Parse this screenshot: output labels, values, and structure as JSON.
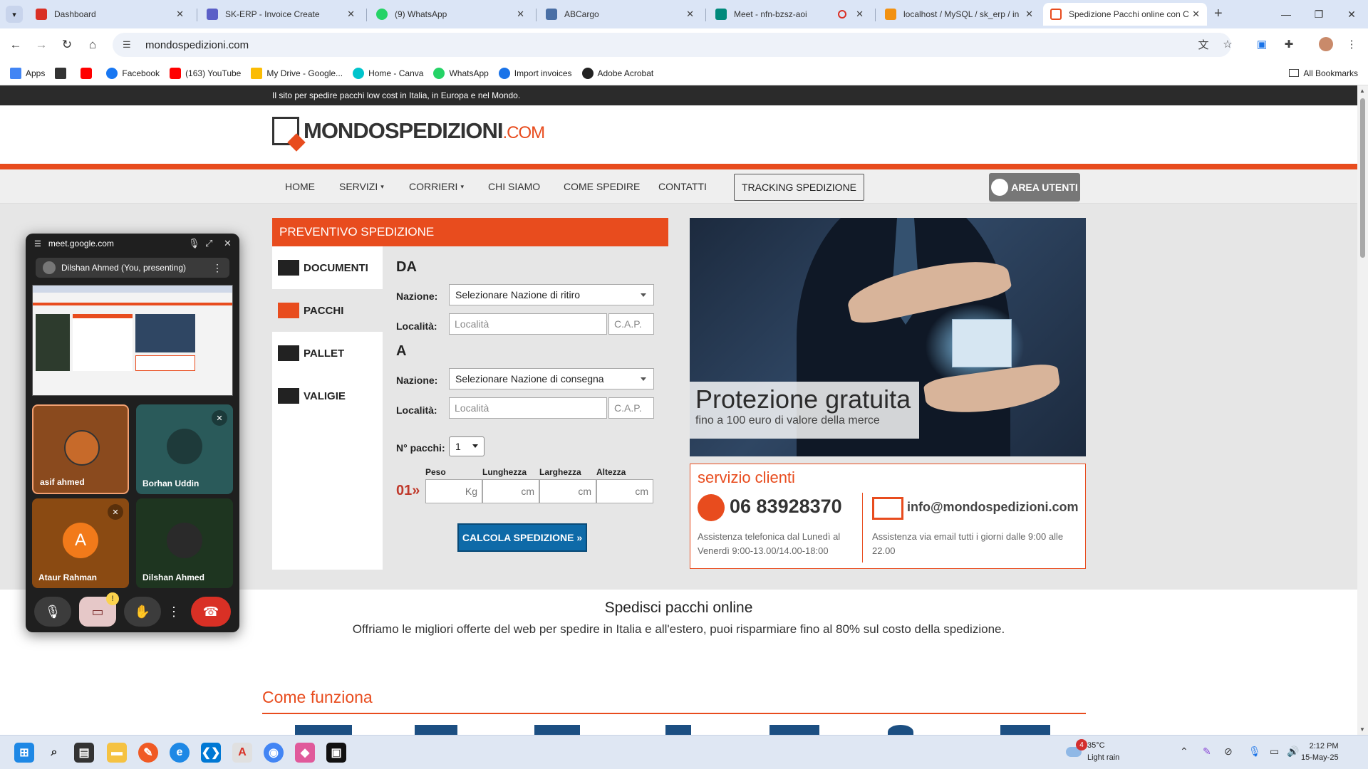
{
  "browser": {
    "tabs": [
      {
        "title": "Dashboard",
        "color": "#d93025"
      },
      {
        "title": "SK-ERP - Invoice Create",
        "color": "#5b5fc7"
      },
      {
        "title": "(9) WhatsApp",
        "color": "#25d366"
      },
      {
        "title": "ABCargo",
        "color": "#4a6fa5"
      },
      {
        "title": "Meet - nfn-bzsz-aoi",
        "color": "#00897b"
      },
      {
        "title": "localhost / MySQL / sk_erp / in",
        "color": "#f29111"
      },
      {
        "title": "Spedizione Pacchi online con C",
        "color": "#e84c1e"
      }
    ],
    "url": "mondospedizioni.com",
    "bookmarks": [
      {
        "label": "Apps",
        "icon": "apps-grid-icon",
        "color": "#4285f4"
      },
      {
        "label": "",
        "icon": "grid-icon",
        "color": "#333333"
      },
      {
        "label": "",
        "icon": "youtube-icon",
        "color": "#ff0000"
      },
      {
        "label": "Facebook",
        "icon": "facebook-icon",
        "color": "#1877f2"
      },
      {
        "label": "(163) YouTube",
        "icon": "youtube-icon",
        "color": "#ff0000"
      },
      {
        "label": "My Drive - Google...",
        "icon": "drive-icon",
        "color": "#fbbc04"
      },
      {
        "label": "Home - Canva",
        "icon": "canva-icon",
        "color": "#00c4cc"
      },
      {
        "label": "WhatsApp",
        "icon": "whatsapp-icon",
        "color": "#25d366"
      },
      {
        "label": "Import invoices",
        "icon": "import-icon",
        "color": "#1a73e8"
      },
      {
        "label": "Adobe Acrobat",
        "icon": "acrobat-icon",
        "color": "#222222"
      }
    ],
    "all_bookmarks": "All Bookmarks"
  },
  "site": {
    "topbar": "Il sito per spedire pacchi low cost in Italia, in Europa e nel Mondo.",
    "logo_main": "MONDOSPEDIZIONI",
    "logo_com": ".COM",
    "nav": [
      "HOME",
      "SERVIZI",
      "CORRIERI",
      "CHI SIAMO",
      "COME SPEDIRE",
      "CONTATTI"
    ],
    "nav_tracking": "TRACKING SPEDIZIONE",
    "nav_area": "AREA UTENTI",
    "quote": {
      "title": "PREVENTIVO SPEDIZIONE",
      "tabs": [
        "DOCUMENTI",
        "PACCHI",
        "PALLET",
        "VALIGIE"
      ],
      "da": "DA",
      "a": "A",
      "nazione_label": "Nazione:",
      "localita_label": "Località:",
      "nazione_ritiro": "Selezionare Nazione di ritiro",
      "nazione_consegna": "Selezionare Nazione di consegna",
      "localita_placeholder": "Località",
      "cap_placeholder": "C.A.P.",
      "npacchi_label": "N° pacchi:",
      "npacchi_value": "1",
      "dims": [
        "Peso",
        "Lunghezza",
        "Larghezza",
        "Altezza"
      ],
      "units": [
        "Kg",
        "cm",
        "cm",
        "cm"
      ],
      "row": "01»",
      "calc": "CALCOLA SPEDIZIONE »"
    },
    "promo": {
      "title": "Protezione gratuita",
      "subtitle": "fino a 100 euro di valore della merce"
    },
    "service": {
      "title": "servizio clienti",
      "phone": "06 83928370",
      "phone_text": "Assistenza telefonica dal Lunedì al Venerdì 9:00-13.00/14.00-18:00",
      "email": "info@mondospedizioni.com",
      "email_text": "Assistenza via email tutti i giorni dalle 9:00 alle 22.00"
    },
    "section_title": "Spedisci pacchi online",
    "section_sub": "Offriamo le migliori offerte del web per spedire in Italia e all'estero, puoi risparmiare fino al 80% sul costo della spedizione.",
    "come_title": "Come funziona"
  },
  "meet": {
    "domain": "meet.google.com",
    "presenting": "Dilshan Ahmed (You, presenting)",
    "participants": [
      {
        "name": "asif ahmed",
        "muted": false
      },
      {
        "name": "Borhan Uddin",
        "muted": true
      },
      {
        "name": "Ataur Rahman",
        "muted": true,
        "initial": "A"
      },
      {
        "name": "Dilshan Ahmed",
        "muted": false
      }
    ]
  },
  "taskbar": {
    "weather_temp": "35°C",
    "weather_desc": "Light rain",
    "weather_badge": "4",
    "time": "2:12 PM",
    "date": "15-May-25"
  }
}
